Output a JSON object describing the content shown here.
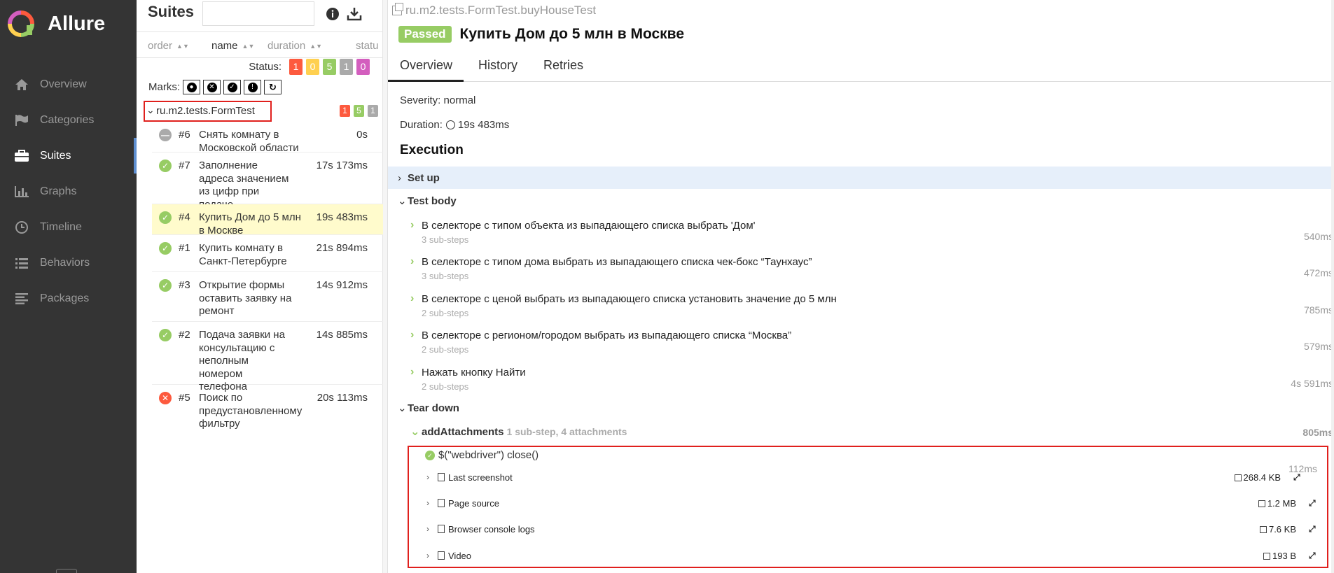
{
  "app": {
    "title": "Allure"
  },
  "sidebar": {
    "items": [
      {
        "label": "Overview",
        "icon": "home-icon",
        "active": false
      },
      {
        "label": "Categories",
        "icon": "flag-icon",
        "active": false
      },
      {
        "label": "Suites",
        "icon": "briefcase-icon",
        "active": true
      },
      {
        "label": "Graphs",
        "icon": "bar-chart-icon",
        "active": false
      },
      {
        "label": "Timeline",
        "icon": "clock-icon",
        "active": false
      },
      {
        "label": "Behaviors",
        "icon": "list-icon",
        "active": false
      },
      {
        "label": "Packages",
        "icon": "align-left-icon",
        "active": false
      }
    ]
  },
  "suites": {
    "title": "Suites",
    "search": {
      "value": "",
      "placeholder": ""
    },
    "columns": {
      "order": "order",
      "name": "name",
      "duration": "duration",
      "status": "statu"
    },
    "status_filter": {
      "label": "Status:",
      "counts": [
        "1",
        "0",
        "5",
        "1",
        "0"
      ]
    },
    "marks_label": "Marks:",
    "group": {
      "name": "ru.m2.tests.FormTest",
      "counts": [
        "1",
        "5",
        "1"
      ]
    },
    "tests": [
      {
        "status": "skipped",
        "order": "#6",
        "name": "Снять комнату в Московской области",
        "duration": "0s"
      },
      {
        "status": "passed",
        "order": "#7",
        "name": "Заполнение адреса значением из цифр при подаче обьявления",
        "duration": "17s 173ms"
      },
      {
        "status": "passed",
        "order": "#4",
        "name": "Купить Дом до 5 млн в Москве",
        "duration": "19s 483ms",
        "selected": true
      },
      {
        "status": "passed",
        "order": "#1",
        "name": "Купить комнату в Санкт-Петербурге",
        "duration": "21s 894ms"
      },
      {
        "status": "passed",
        "order": "#3",
        "name": "Открытие формы оставить заявку на ремонт",
        "duration": "14s 912ms"
      },
      {
        "status": "passed",
        "order": "#2",
        "name": "Подача заявки на консультацию с неполным номером телефона",
        "duration": "14s 885ms"
      },
      {
        "status": "failed",
        "order": "#5",
        "name": "Поиск по предустановленному фильтру",
        "duration": "20s 113ms"
      }
    ]
  },
  "detail": {
    "fullname": "ru.m2.tests.FormTest.buyHouseTest",
    "status": "Passed",
    "title": "Купить Дом до 5 млн в Москве",
    "tabs": [
      "Overview",
      "History",
      "Retries"
    ],
    "severity": "Severity: normal",
    "duration_label": "Duration:",
    "duration": "19s 483ms",
    "execution_title": "Execution",
    "setup": "Set up",
    "body": "Test body",
    "teardown": "Tear down",
    "steps": [
      {
        "name": "В селекторе с типом объекта из выпадающего списка выбрать 'Дом'",
        "sub": "3 sub-steps",
        "duration": "540ms"
      },
      {
        "name": "В селекторе с типом дома выбрать из выпадающего списка чек-бокс “Таунхаус”",
        "sub": "3 sub-steps",
        "duration": "472ms"
      },
      {
        "name": "В селекторе с ценой выбрать из выпадающего списка установить значение до 5 млн",
        "sub": "2 sub-steps",
        "duration": "785ms"
      },
      {
        "name": "В селекторе с регионом/городом выбрать из выпадающего списка “Москва”",
        "sub": "2 sub-steps",
        "duration": "579ms"
      },
      {
        "name": "Нажать кнопку Найти",
        "sub": "2 sub-steps",
        "duration": "4s 591ms"
      }
    ],
    "add_attachments": {
      "name": "addAttachments",
      "sub": "1 sub-step, 4 attachments",
      "duration": "805ms"
    },
    "inner_step": {
      "name": "$(\"webdriver\") close()",
      "duration": "112ms"
    },
    "attachments": [
      {
        "name": "Last screenshot",
        "size": "268.4 KB"
      },
      {
        "name": "Page source",
        "size": "1.2 MB"
      },
      {
        "name": "Browser console logs",
        "size": "7.6 KB"
      },
      {
        "name": "Video",
        "size": "193 B"
      }
    ]
  },
  "colors": {
    "passed": "#97cc64",
    "failed": "#fd5a3e",
    "broken": "#ffd050",
    "skipped": "#aaaaaa",
    "unknown": "#d35ebe",
    "sidebar": "#343434"
  }
}
